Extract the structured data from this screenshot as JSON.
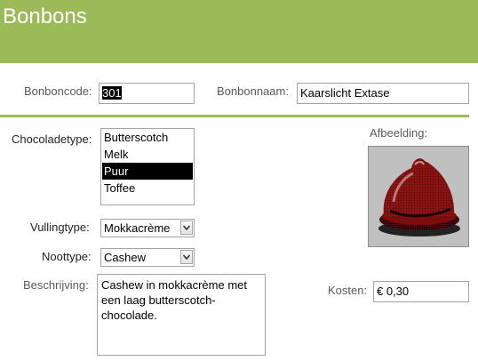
{
  "header": {
    "title": "Bonbons"
  },
  "colors": {
    "accent": "#9bbb59",
    "selection": "#000000"
  },
  "form": {
    "bonboncode": {
      "label": "Bonboncode:",
      "value": "301"
    },
    "bonbonnaam": {
      "label": "Bonbonnaam:",
      "value": "Kaarslicht Extase"
    },
    "chocoladetype": {
      "label": "Chocoladetype:",
      "options": [
        "Butterscotch",
        "Melk",
        "Puur",
        "Toffee"
      ],
      "selected": "Puur"
    },
    "afbeelding": {
      "label": "Afbeelding:"
    },
    "vullingtype": {
      "label": "Vullingtype:",
      "value": "Mokkacrème"
    },
    "noottype": {
      "label": "Noottype:",
      "value": "Cashew"
    },
    "beschrijving": {
      "label": "Beschrijving:",
      "value": "Cashew in mokkacrème met een laag butterscotch-chocolade."
    },
    "kosten": {
      "label": "Kosten:",
      "value": "€ 0,30"
    }
  },
  "icons": {
    "dropdown": "chevron-down-icon",
    "picture": "bonbon-image"
  }
}
